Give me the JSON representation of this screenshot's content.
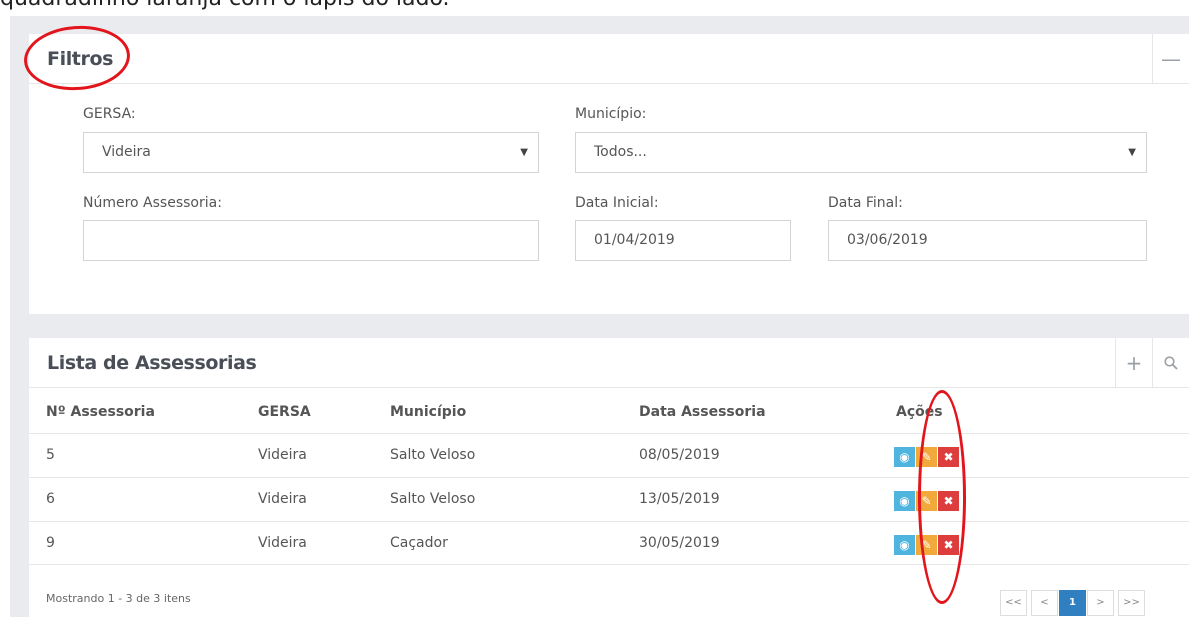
{
  "caption": "quadradinho laranja com o lápis do lado.",
  "filtros": {
    "title": "Filtros",
    "collapse_icon": "minus-icon",
    "gersa_label": "GERSA:",
    "gersa_value": "Videira",
    "municipio_label": "Município:",
    "municipio_value": "Todos...",
    "numero_label": "Número Assessoria:",
    "numero_value": "",
    "data_inicial_label": "Data Inicial:",
    "data_inicial_value": "01/04/2019",
    "data_final_label": "Data Final:",
    "data_final_value": "03/06/2019"
  },
  "lista": {
    "title": "Lista de Assessorias",
    "add_icon": "plus-icon",
    "search_icon": "search-icon",
    "columns": [
      "Nº Assessoria",
      "GERSA",
      "Município",
      "Data Assessoria",
      "Ações"
    ],
    "rows": [
      [
        "5",
        "Videira",
        "Salto Veloso",
        "08/05/2019"
      ],
      [
        "6",
        "Videira",
        "Salto Veloso",
        "13/05/2019"
      ],
      [
        "9",
        "Videira",
        "Caçador",
        "30/05/2019"
      ]
    ],
    "footer": "Mostrando 1 - 3 de 3 itens",
    "pager": [
      "<<",
      "<",
      "1",
      ">",
      ">>"
    ],
    "current_page": "1"
  },
  "colors": {
    "view": "#4fb5de",
    "edit": "#f2a93b",
    "delete": "#dd3d3d",
    "annotation": "#e2141c",
    "pager_active": "#2f7fc1"
  }
}
